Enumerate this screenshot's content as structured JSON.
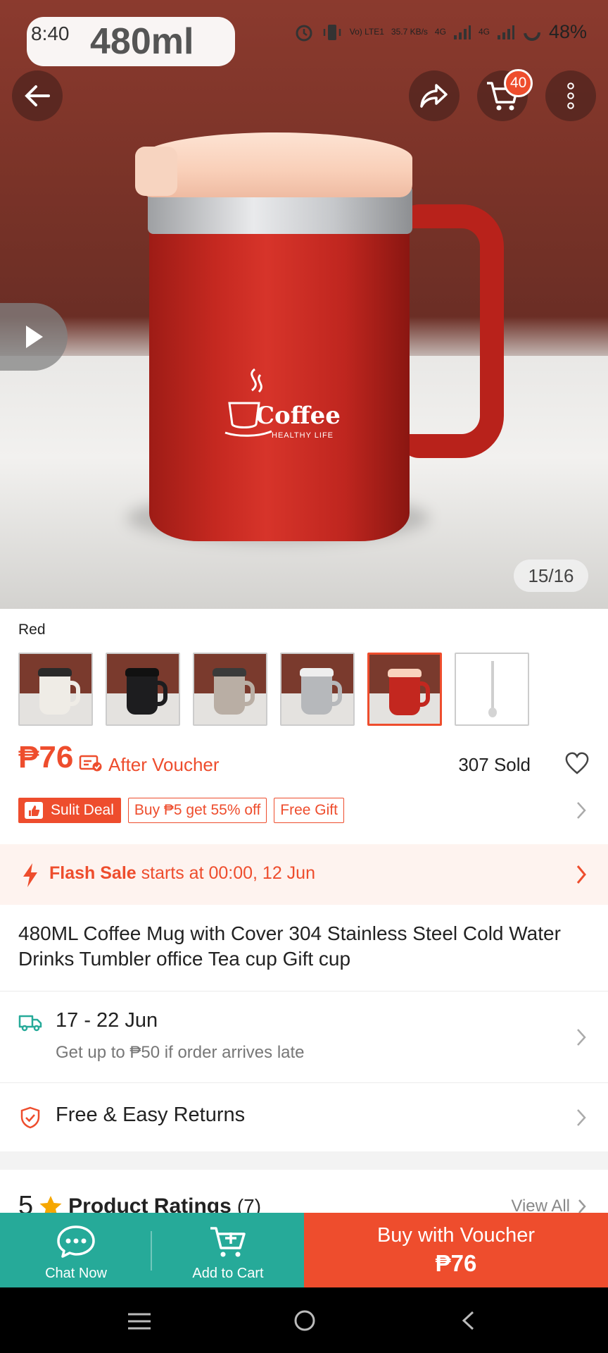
{
  "status_bar": {
    "time": "8:40",
    "volte": "Vo) LTE1",
    "speed": "35.7 KB/s",
    "net1": "4G",
    "net2": "4G",
    "battery": "48%"
  },
  "hero": {
    "size_label": "480ml",
    "mug_logo": "Coffee",
    "mug_logo_sub": "HEALTHY LIFE",
    "cart_count": "40",
    "image_counter": "15/16"
  },
  "variation": {
    "selected_label": "Red",
    "thumbnails": [
      {
        "color": "#efece6",
        "handle": "#efece6",
        "lid": "#2a2a2a",
        "name": "White"
      },
      {
        "color": "#1d1d1f",
        "handle": "#1d1d1f",
        "lid": "#111111",
        "name": "Black"
      },
      {
        "color": "#b9aea4",
        "handle": "#b9aea4",
        "lid": "#3a3a3a",
        "name": "Khaki"
      },
      {
        "color": "#b6b8bb",
        "handle": "#b6b8bb",
        "lid": "#eeeeee",
        "name": "Gray"
      },
      {
        "color": "#c3271f",
        "handle": "#c3271f",
        "lid": "#f9d2bd",
        "name": "Red"
      },
      {
        "color": "#ffffff",
        "handle": "#ffffff",
        "lid": "#ffffff",
        "name": "Spoon"
      }
    ]
  },
  "price": {
    "amount": "₱76",
    "after_voucher": "After Voucher",
    "sold": "307 Sold"
  },
  "tags": {
    "deal": "Sulit Deal",
    "promo": "Buy ₱5 get 55% off",
    "gift": "Free Gift"
  },
  "flash_sale": {
    "label": "Flash Sale",
    "text": " starts at 00:00, 12 Jun"
  },
  "product": {
    "title": "480ML Coffee Mug with Cover 304 Stainless Steel Cold Water Drinks Tumbler office Tea cup Gift cup"
  },
  "shipping": {
    "dates": "17 - 22 Jun",
    "guarantee": "Get up to ₱50 if order arrives late"
  },
  "returns": {
    "label": "Free & Easy Returns"
  },
  "ratings": {
    "score": "5",
    "label": "Product Ratings",
    "count": "(7)",
    "view_all": "View All"
  },
  "bottom_bar": {
    "chat": "Chat Now",
    "add_cart": "Add to Cart",
    "buy_line1": "Buy with Voucher",
    "buy_line2": "₱76"
  },
  "colors": {
    "brand": "#ee4d2d",
    "teal": "#26aa99"
  }
}
